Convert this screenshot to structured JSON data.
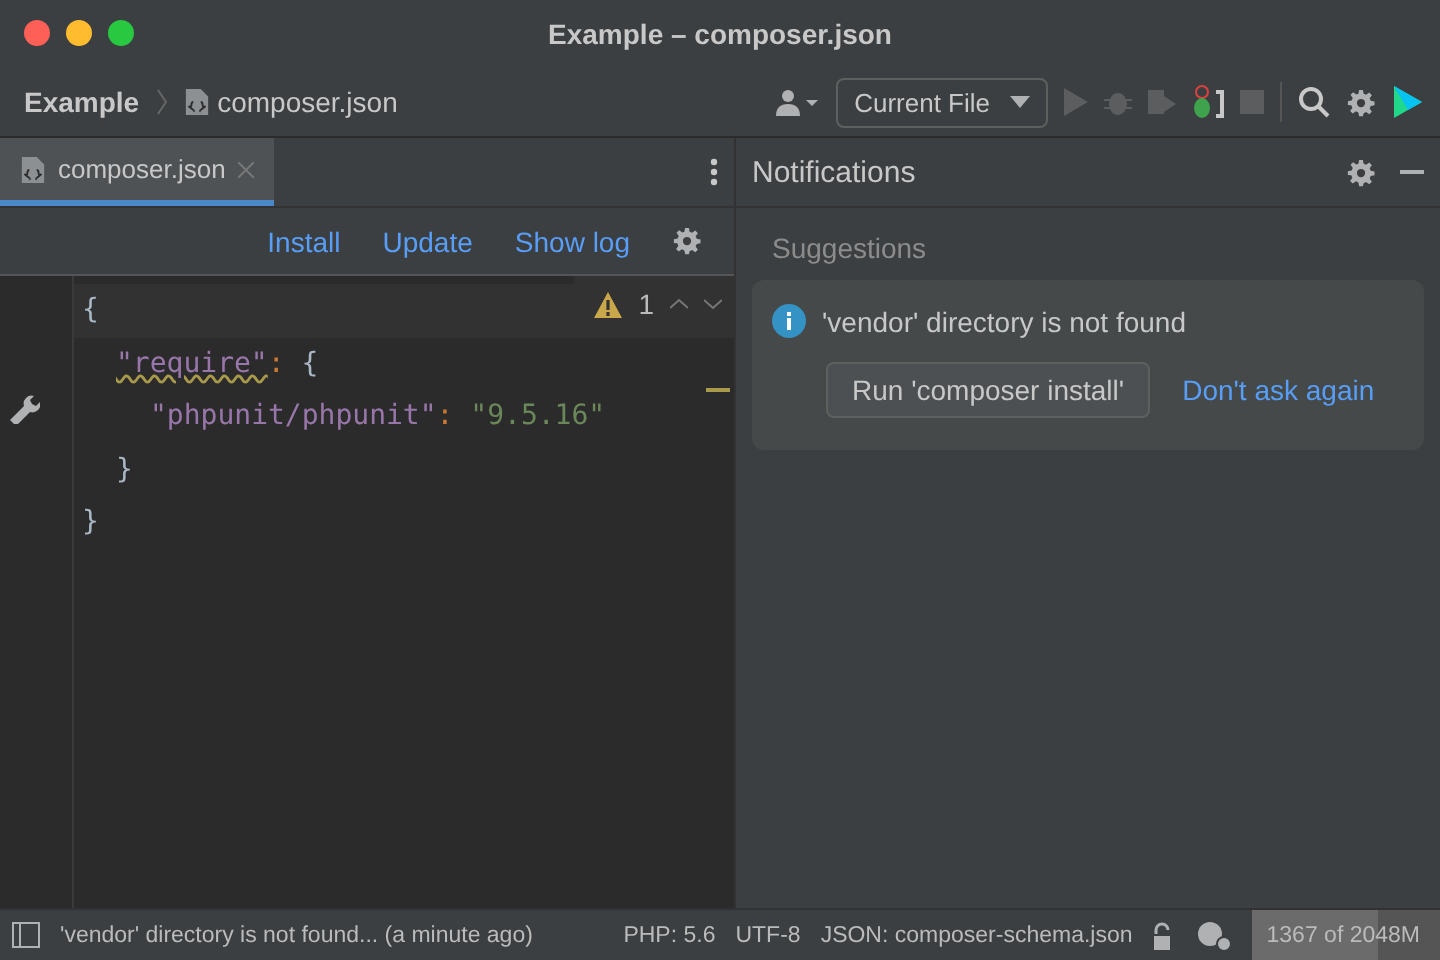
{
  "window": {
    "title": "Example – composer.json"
  },
  "breadcrumbs": [
    "Example",
    "composer.json"
  ],
  "run_config": {
    "label": "Current File"
  },
  "tabs": [
    {
      "label": "composer.json",
      "selected": true
    }
  ],
  "editor_actions": [
    "Install",
    "Update",
    "Show log"
  ],
  "inspections": {
    "count": "1"
  },
  "code": [
    {
      "tokens": [
        {
          "kind": "punct",
          "text": "{"
        }
      ],
      "children": [
        {
          "tokens": [
            {
              "kind": "key",
              "text": "\"require\"",
              "warning": true
            },
            {
              "kind": "colon",
              "text": ":"
            },
            {
              "kind": "punct",
              "text": " {"
            }
          ],
          "children": [
            {
              "tokens": [
                {
                  "kind": "key",
                  "text": "\"phpunit/phpunit\"",
                  "warning": false
                },
                {
                  "kind": "colon",
                  "text": ":"
                },
                {
                  "kind": "string",
                  "text": " \"9.5.16\""
                }
              ]
            }
          ]
        },
        {
          "tokens": [
            {
              "kind": "punct",
              "text": "}"
            }
          ]
        }
      ]
    },
    {
      "tokens": [
        {
          "kind": "punct",
          "text": "}"
        }
      ]
    }
  ],
  "notifications": {
    "title": "Notifications",
    "section": "Suggestions",
    "items": [
      {
        "message": "'vendor' directory is not found",
        "action": "Run 'composer install'",
        "link": "Don't ask again"
      }
    ]
  },
  "status_bar": {
    "message": "'vendor' directory is not found... (a minute ago)",
    "php": "PHP: 5.6",
    "encoding": "UTF-8",
    "schema": "JSON: composer-schema.json",
    "memory": {
      "text": "1367 of 2048M",
      "level": 0.667
    }
  }
}
